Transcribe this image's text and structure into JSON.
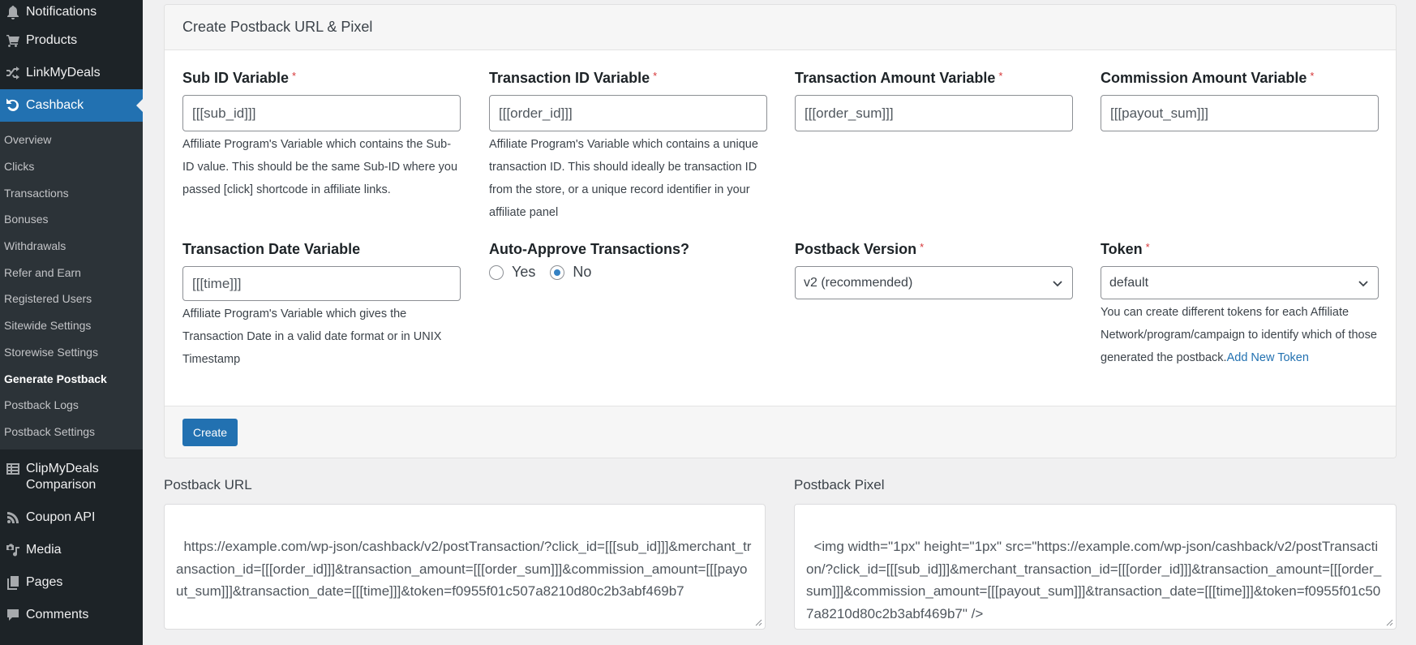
{
  "sidebar": {
    "top_items": [
      {
        "label": "Notifications",
        "icon": "bell-icon"
      },
      {
        "label": "Products",
        "icon": "cart-icon"
      },
      {
        "label": "LinkMyDeals",
        "icon": "shuffle-icon"
      },
      {
        "label": "Cashback",
        "icon": "refresh-icon",
        "active": true
      }
    ],
    "submenu": [
      {
        "label": "Overview"
      },
      {
        "label": "Clicks"
      },
      {
        "label": "Transactions"
      },
      {
        "label": "Bonuses"
      },
      {
        "label": "Withdrawals"
      },
      {
        "label": "Refer and Earn"
      },
      {
        "label": "Registered Users"
      },
      {
        "label": "Sitewide Settings"
      },
      {
        "label": "Storewise Settings"
      },
      {
        "label": "Generate Postback",
        "current": true
      },
      {
        "label": "Postback Logs"
      },
      {
        "label": "Postback Settings"
      }
    ],
    "bottom_items": [
      {
        "label_line1": "ClipMyDeals",
        "label_line2": "Comparison",
        "icon": "list-icon"
      },
      {
        "label": "Coupon API",
        "icon": "rss-icon"
      },
      {
        "label": "Media",
        "icon": "media-icon"
      },
      {
        "label": "Pages",
        "icon": "pages-icon"
      },
      {
        "label": "Comments",
        "icon": "comment-icon"
      }
    ]
  },
  "card": {
    "title": "Create Postback URL & Pixel",
    "required_mark": "*",
    "fields": {
      "sub_id": {
        "label": "Sub ID Variable",
        "value": "[[[sub_id]]]",
        "help": "Affiliate Program's Variable which contains the Sub-ID value. This should be the same Sub-ID where you passed [click] shortcode in affiliate links."
      },
      "transaction_id": {
        "label": "Transaction ID Variable",
        "value": "[[[order_id]]]",
        "help": "Affiliate Program's Variable which contains a unique transaction ID. This should ideally be transaction ID from the store, or a unique record identifier in your affiliate panel"
      },
      "transaction_amount": {
        "label": "Transaction Amount Variable",
        "value": "[[[order_sum]]]"
      },
      "commission_amount": {
        "label": "Commission Amount Variable",
        "value": "[[[payout_sum]]]"
      },
      "transaction_date": {
        "label": "Transaction Date Variable",
        "value": "[[[time]]]",
        "help": "Affiliate Program's Variable which gives the Transaction Date in a valid date format or in UNIX Timestamp"
      },
      "auto_approve": {
        "label": "Auto-Approve Transactions?",
        "options": [
          "Yes",
          "No"
        ],
        "selected": "No"
      },
      "postback_version": {
        "label": "Postback Version",
        "selected": "v2 (recommended)"
      },
      "token": {
        "label": "Token",
        "selected": "default",
        "help": "You can create different tokens for each Affiliate Network/program/campaign to identify which of those generated the postback.",
        "link": "Add New Token"
      }
    },
    "create_button": "Create"
  },
  "output": {
    "url_label": "Postback URL",
    "url_value": "https://example.com/wp-json/cashback/v2/postTransaction/?click_id=[[[sub_id]]]&merchant_transaction_id=[[[order_id]]]&transaction_amount=[[[order_sum]]]&commission_amount=[[[payout_sum]]]&transaction_date=[[[time]]]&token=f0955f01c507a8210d80c2b3abf469b7",
    "pixel_label": "Postback Pixel",
    "pixel_value": "<img width=\"1px\" height=\"1px\" src=\"https://example.com/wp-json/cashback/v2/postTransaction/?click_id=[[[sub_id]]]&merchant_transaction_id=[[[order_id]]]&transaction_amount=[[[order_sum]]]&commission_amount=[[[payout_sum]]]&transaction_date=[[[time]]]&token=f0955f01c507a8210d80c2b3abf469b7\" />"
  },
  "colors": {
    "accent": "#2271b1",
    "sidebar_bg": "#1d2327",
    "submenu_bg": "#2c3338",
    "required": "#d63638"
  }
}
